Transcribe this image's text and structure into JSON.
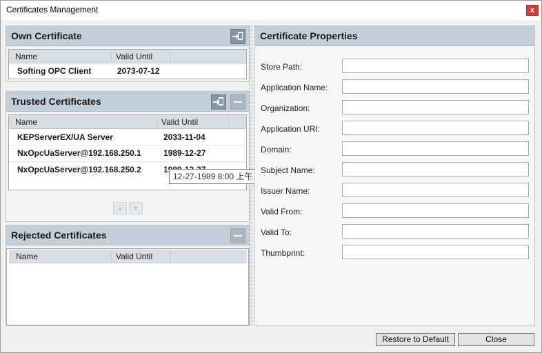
{
  "window": {
    "title": "Certificates Management",
    "close_label": "x"
  },
  "own_certificate": {
    "title": "Own Certificate",
    "columns": [
      "Name",
      "Valid Until"
    ],
    "rows": [
      {
        "name": "Softing OPC Client",
        "valid_until": "2073-07-12"
      }
    ]
  },
  "trusted_certificates": {
    "title": "Trusted Certificates",
    "columns": [
      "Name",
      "Valid Until"
    ],
    "rows": [
      {
        "name": "KEPServerEX/UA Server",
        "valid_until": "2033-11-04"
      },
      {
        "name": "NxOpcUaServer@192.168.250.1",
        "valid_until": "1989-12-27"
      },
      {
        "name": "NxOpcUaServer@192.168.250.2",
        "valid_until": "1989-12-27"
      }
    ],
    "tooltip": "12-27-1989 8:00 上午"
  },
  "rejected_certificates": {
    "title": "Rejected Certificates",
    "columns": [
      "Name",
      "Valid Until"
    ]
  },
  "properties": {
    "title": "Certificate Properties",
    "fields": [
      {
        "label": "Store Path:",
        "value": ""
      },
      {
        "label": "Application Name:",
        "value": ""
      },
      {
        "label": "Organization:",
        "value": ""
      },
      {
        "label": "Application URI:",
        "value": ""
      },
      {
        "label": "Domain:",
        "value": ""
      },
      {
        "label": "Subject Name:",
        "value": ""
      },
      {
        "label": "Issuer Name:",
        "value": ""
      },
      {
        "label": "Valid From:",
        "value": ""
      },
      {
        "label": "Valid To:",
        "value": ""
      },
      {
        "label": "Thumbprint:",
        "value": ""
      }
    ]
  },
  "footer": {
    "restore_label": "Restore to Default",
    "close_label": "Close"
  },
  "icons": {
    "import": "import-icon",
    "remove": "remove-icon",
    "up": "up-arrow-icon",
    "down": "down-arrow-icon"
  },
  "colors": {
    "header": "#c3d0da",
    "close": "#c8423b"
  }
}
